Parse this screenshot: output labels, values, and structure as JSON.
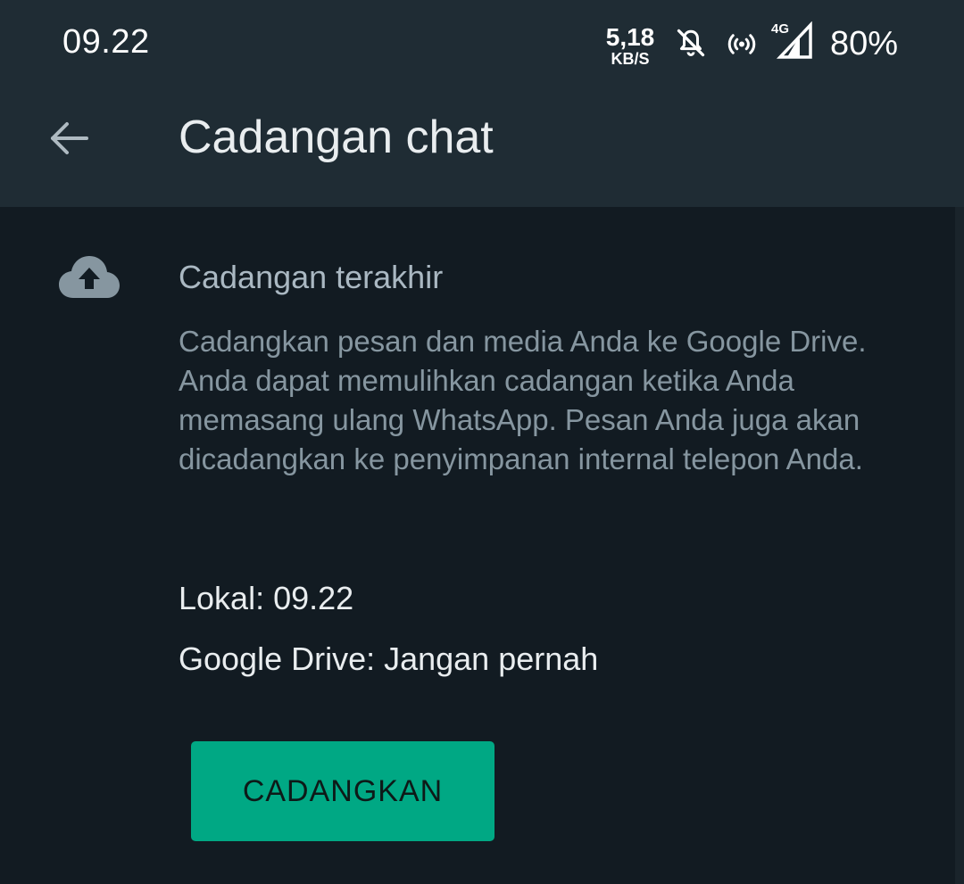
{
  "status_bar": {
    "time": "09.22",
    "net_speed_value": "5,18",
    "net_speed_unit": "KB/S",
    "network_type": "4G",
    "battery": "80%",
    "icons": [
      "bell-off-icon",
      "hotspot-icon",
      "signal-icon"
    ]
  },
  "toolbar": {
    "back_icon": "arrow-left-icon",
    "title": "Cadangan chat"
  },
  "backup_section": {
    "icon": "cloud-upload-icon",
    "title": "Cadangan terakhir",
    "description": "Cadangkan pesan dan media Anda ke Google Drive. Anda dapat memulihkan cadangan ketika Anda memasang ulang WhatsApp. Pesan Anda juga akan dicadangkan ke penyimpanan internal telepon Anda.",
    "local": "Lokal: 09.22",
    "google_drive": "Google Drive: Jangan pernah",
    "button_label": "CADANGKAN"
  },
  "colors": {
    "header_bg": "#1f2c34",
    "page_bg": "#121b22",
    "accent": "#00a884"
  }
}
